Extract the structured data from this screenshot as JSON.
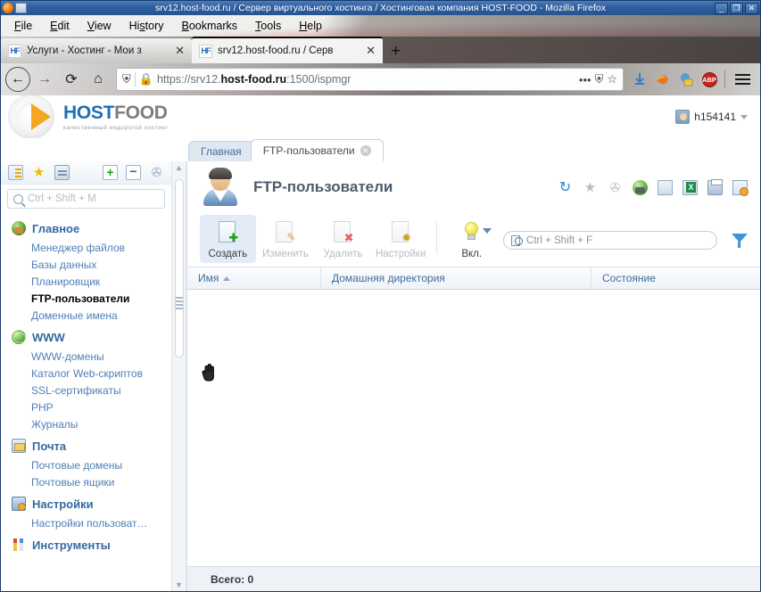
{
  "window": {
    "title": "srv12.host-food.ru / Сервер виртуального хостинга / Хостинговая компания HOST-FOOD - Mozilla Firefox",
    "minimize": "_",
    "maximize": "❐",
    "close": "✕"
  },
  "menubar": {
    "items": [
      {
        "label": "File",
        "accel": "F"
      },
      {
        "label": "Edit",
        "accel": "E"
      },
      {
        "label": "View",
        "accel": "V"
      },
      {
        "label": "History",
        "accel": "s"
      },
      {
        "label": "Bookmarks",
        "accel": "B"
      },
      {
        "label": "Tools",
        "accel": "T"
      },
      {
        "label": "Help",
        "accel": "H"
      }
    ]
  },
  "browser_tabs": {
    "tabs": [
      {
        "favicon": "HF",
        "title": "Услуги - Хостинг - Мои з",
        "active": false,
        "close": "✕"
      },
      {
        "favicon": "HF",
        "title": "srv12.host-food.ru / Серв",
        "active": true,
        "close": "✕"
      }
    ],
    "new_tab": "+"
  },
  "navbar": {
    "back": "←",
    "forward": "→",
    "reload": "⟳",
    "home": "⌂",
    "shield_icon": "shield",
    "lock_icon": "lock",
    "url_scheme": "https://srv12.",
    "url_host": "host-food.ru",
    "url_path": ":1500/ispmgr",
    "url_full": "https://srv12.host-food.ru:1500/ispmgr",
    "page_actions": "•••",
    "tracking": "⛨",
    "bookmark_star": "☆",
    "extensions": [
      "download-icon",
      "firefox-addon-icon",
      "addon-icon",
      "adblock-plus-icon"
    ],
    "adblock_label": "ABP",
    "menu": "hamburger"
  },
  "brand": {
    "logo_host": "HOST",
    "logo_food": "FOOD",
    "tagline": "качественный недорогой хостинг"
  },
  "user": {
    "name": "h154141"
  },
  "app_tabs": [
    {
      "label": "Главная",
      "active": false,
      "closable": false
    },
    {
      "label": "FTP-пользователи",
      "active": true,
      "closable": true,
      "close": "✕"
    }
  ],
  "sidebar": {
    "toolbar": [
      {
        "name": "tree-view-icon",
        "label": "Дерево"
      },
      {
        "name": "favorites-star-icon",
        "label": "Избранное",
        "glyph": "★"
      },
      {
        "name": "clipboard-icon",
        "label": "Буфер"
      },
      {
        "name": "expand-all-icon",
        "glyph": "+"
      },
      {
        "name": "collapse-all-icon",
        "glyph": "−"
      },
      {
        "name": "pin-icon",
        "glyph": "📌"
      }
    ],
    "search": {
      "value": "",
      "placeholder": "Ctrl + Shift + M"
    },
    "groups": [
      {
        "icon": "globe-box-icon",
        "title": "Главное",
        "items": [
          {
            "label": "Менеджер файлов",
            "active": false
          },
          {
            "label": "Базы данных",
            "active": false
          },
          {
            "label": "Планировщик",
            "active": false
          },
          {
            "label": "FTP-пользователи",
            "active": true
          },
          {
            "label": "Доменные имена",
            "active": false
          }
        ]
      },
      {
        "icon": "globe-icon",
        "title": "WWW",
        "items": [
          {
            "label": "WWW-домены",
            "active": false
          },
          {
            "label": "Каталог Web-скриптов",
            "active": false
          },
          {
            "label": "SSL-сертификаты",
            "active": false
          },
          {
            "label": "PHP",
            "active": false
          },
          {
            "label": "Журналы",
            "active": false
          }
        ]
      },
      {
        "icon": "mail-icon",
        "title": "Почта",
        "items": [
          {
            "label": "Почтовые домены",
            "active": false
          },
          {
            "label": "Почтовые ящики",
            "active": false
          }
        ]
      },
      {
        "icon": "monitor-settings-icon",
        "title": "Настройки",
        "items": [
          {
            "label": "Настройки пользоват…",
            "active": false
          }
        ]
      },
      {
        "icon": "tools-icon",
        "title": "Инструменты",
        "items": []
      }
    ],
    "scrollbar": {
      "up": "▲",
      "down": "▼"
    }
  },
  "main": {
    "page_title": "FTP-пользователи",
    "avatar_icon": "ftp-user-avatar",
    "title_icons": [
      {
        "name": "refresh-icon",
        "glyph": "↻"
      },
      {
        "name": "favorite-star-icon",
        "glyph": "★"
      },
      {
        "name": "pin-icon",
        "glyph": "📌"
      },
      {
        "name": "html-export-icon"
      },
      {
        "name": "doc-export-icon"
      },
      {
        "name": "excel-export-icon"
      },
      {
        "name": "print-icon"
      },
      {
        "name": "table-settings-icon"
      }
    ],
    "toolbar": [
      {
        "label": "Создать",
        "name": "create-button",
        "state": "selected",
        "badge": "plus"
      },
      {
        "label": "Изменить",
        "name": "edit-button",
        "state": "disabled",
        "badge": "pencil"
      },
      {
        "label": "Удалить",
        "name": "delete-button",
        "state": "disabled",
        "badge": "cross"
      },
      {
        "label": "Настройки",
        "name": "settings-button",
        "state": "disabled",
        "badge": "gear"
      },
      {
        "label": "Вкл.",
        "name": "enable-button",
        "state": "normal",
        "badge": "bulb"
      }
    ],
    "search": {
      "value": "",
      "placeholder": "Ctrl + Shift + F"
    },
    "filter_icon": "filter-funnel-icon",
    "table": {
      "columns": [
        {
          "label": "Имя",
          "sort": "asc"
        },
        {
          "label": "Домашняя директория",
          "sort": null
        },
        {
          "label": "Состояние",
          "sort": null
        }
      ],
      "rows": []
    },
    "status": "Всего: 0"
  },
  "colors": {
    "accent": "#35699f",
    "link": "#4f7fb5",
    "titlebar": "#2f5f9e",
    "brand_blue": "#1f6fb5",
    "brand_orange": "#f5a623"
  }
}
